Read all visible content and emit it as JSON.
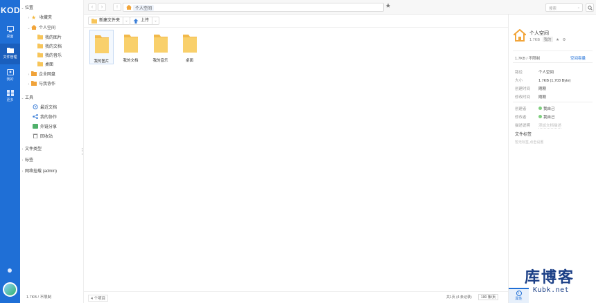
{
  "app": {
    "logo_text": "KOD"
  },
  "rail": {
    "items": [
      {
        "label": "桌面",
        "icon": "desktop-icon"
      },
      {
        "label": "文件管理",
        "icon": "folder-icon",
        "active": true
      },
      {
        "label": "我的",
        "icon": "user-icon"
      },
      {
        "label": "更多",
        "icon": "grid-icon"
      }
    ]
  },
  "tree": {
    "sections": {
      "location": "位置",
      "favorites": "收藏夹",
      "personal_space": "个人空间",
      "my_pictures": "我的图片",
      "my_documents": "我的文档",
      "my_music": "我的音乐",
      "desktop": "桌面",
      "enterprise_disk": "企业网盘",
      "shared_with_me": "与我协作",
      "tools": "工具",
      "recent_docs": "最近文档",
      "my_collab": "我的协作",
      "external_share": "外链分享",
      "recycle_bin": "回收站",
      "file_types": "文件类型",
      "tags": "标签",
      "network_mount": "网络挂载 (admin)"
    },
    "status": "1.7KB / 不限制"
  },
  "topbar": {
    "back": "‹",
    "forward": "›",
    "up": "↑",
    "path": "个人空间",
    "search_placeholder": "搜索"
  },
  "toolbar": {
    "new_folder": "新建文件夹",
    "upload": "上传"
  },
  "files": [
    {
      "name": "我的图片",
      "selected": true
    },
    {
      "name": "我的文档"
    },
    {
      "name": "我的音乐"
    },
    {
      "name": "桌面"
    }
  ],
  "statusbar": {
    "count": "4 个项目",
    "pager": "共1页 (4 条记录)",
    "per_page": "100 条/页"
  },
  "panel": {
    "title": "个人空间",
    "size_short": "1.7KB",
    "perm": "我的",
    "quota": "1.7KB / 不限制",
    "quota_link": "空间容量",
    "props": [
      {
        "k": "路径",
        "v": "个人空间"
      },
      {
        "k": "大小",
        "v": "1.7KB (1,703 Byte)"
      },
      {
        "k": "创建时间",
        "v": "刚刚"
      },
      {
        "k": "修改时间",
        "v": "刚刚"
      },
      {
        "k": "创建者",
        "v": "我自己"
      },
      {
        "k": "修改者",
        "v": "我自己"
      },
      {
        "k": "描述说明",
        "v": "添加文档描述"
      }
    ],
    "tag_title": "文件标签",
    "tag_note": "暂无标签,点击设置",
    "info_tab": "属性"
  },
  "watermark": {
    "cn": "库博客",
    "en": "Kubk.net"
  },
  "colors": {
    "accent": "#1f6fd6",
    "folder": "#f7c55a",
    "watermark": "#1b3f86"
  }
}
